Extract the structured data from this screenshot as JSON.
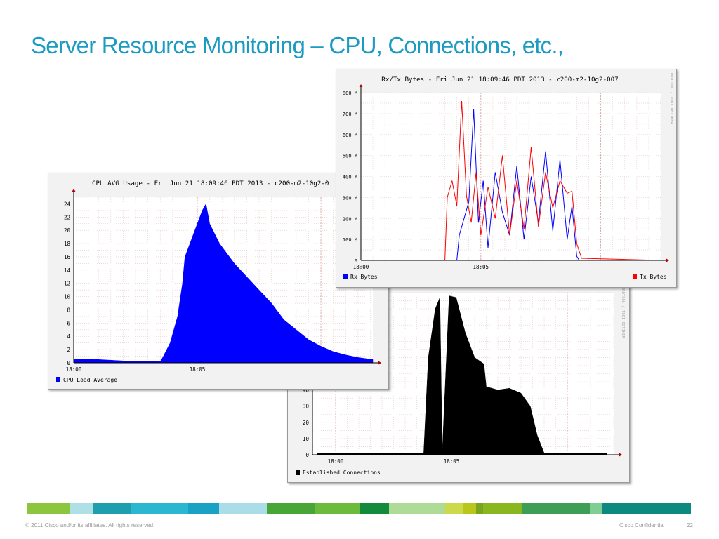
{
  "slide": {
    "title": "Server Resource Monitoring – CPU, Connections,  etc.,",
    "footer_copyright": "© 2011 Cisco and/or its affiliates. All rights reserved.",
    "footer_confidential": "Cisco Confidential",
    "page_number": "22",
    "color_bar": [
      "#8cc63e",
      "#aee0e6",
      "#1f9fae",
      "#2bb7d0",
      "#1aa2c4",
      "#aadde8",
      "#4aa537",
      "#6dbb3c",
      "#138a3c",
      "#aedc98",
      "#ccd94a",
      "#b9c61c",
      "#7aa322",
      "#8ab61f",
      "#3e9e56",
      "#7fcf95",
      "#0d8a7f"
    ]
  },
  "chart_data": [
    {
      "panel": "established-connections",
      "type": "area",
      "title": "",
      "sidebar_text": "RRDTOOL / TOBI OETIKER",
      "legend": [
        {
          "label": "Established Connections",
          "color": "#000000"
        }
      ],
      "x_tick_labels": [
        "18:00",
        "18:05"
      ],
      "xlim_minutes": [
        -1,
        12
      ],
      "y_ticks": [
        0,
        10,
        20,
        30,
        40
      ],
      "ylim": [
        0,
        100
      ],
      "series": [
        {
          "name": "Established Connections",
          "color": "#000000",
          "x": [
            -0.8,
            3.5,
            3.8,
            4.0,
            4.3,
            4.5,
            4.6,
            4.9,
            5.2,
            5.6,
            6.0,
            6.4,
            6.5,
            7.0,
            7.5,
            8.0,
            8.4,
            8.7,
            9.0,
            11.7
          ],
          "values": [
            1,
            1,
            1,
            60,
            90,
            97,
            1,
            98,
            97,
            75,
            60,
            56,
            42,
            40,
            41,
            38,
            30,
            12,
            1,
            1
          ]
        }
      ]
    },
    {
      "panel": "cpu-avg-usage",
      "type": "area",
      "title": "CPU AVG Usage - Fri Jun 21 18:09:46 PDT 2013 - c200-m2-10g2-0",
      "legend": [
        {
          "label": "CPU Load Average",
          "color": "#0000ff"
        }
      ],
      "x_tick_labels": [
        "18:00",
        "18:05"
      ],
      "xlim_minutes": [
        0,
        12.1
      ],
      "y_ticks": [
        0,
        2,
        4,
        6,
        8,
        10,
        12,
        14,
        16,
        18,
        20,
        22,
        24
      ],
      "ylim": [
        0,
        25
      ],
      "series": [
        {
          "name": "CPU Load Average",
          "color": "#0000ff",
          "x": [
            0,
            1,
            2,
            3.5,
            3.6,
            3.9,
            4.2,
            4.4,
            4.5,
            4.9,
            5.2,
            5.35,
            5.5,
            5.9,
            6.5,
            7.0,
            7.5,
            8.0,
            8.5,
            9.0,
            9.5,
            10.0,
            10.5,
            11.0,
            11.5,
            12.1
          ],
          "values": [
            0.6,
            0.5,
            0.3,
            0.2,
            0.8,
            3,
            7,
            12,
            16,
            20,
            23,
            24,
            21,
            18,
            15,
            13,
            11,
            9,
            6.5,
            5,
            3.5,
            2.5,
            1.7,
            1.2,
            0.8,
            0.5
          ]
        }
      ]
    },
    {
      "panel": "rx-tx-bytes",
      "type": "line",
      "title": "Rx/Tx Bytes - Fri Jun 21 18:09:46 PDT 2013 - c200-m2-10g2-007",
      "sidebar_text": "RRDTOOL / TOBI OETIKER",
      "legend": [
        {
          "label": "Rx Bytes",
          "color": "#0000ff"
        },
        {
          "label": "Tx Bytes",
          "color": "#ff0000"
        }
      ],
      "x_tick_labels": [
        "18:00",
        "18:05"
      ],
      "xlim_minutes": [
        0,
        12.5
      ],
      "y_tick_labels": [
        "0",
        "100 M",
        "200 M",
        "300 M",
        "400 M",
        "500 M",
        "600 M",
        "700 M",
        "800 M"
      ],
      "ylim": [
        0,
        800
      ],
      "series": [
        {
          "name": "Rx Bytes",
          "color": "#0000ff",
          "x": [
            0,
            4.0,
            4.1,
            4.5,
            4.7,
            4.9,
            5.1,
            5.3,
            5.6,
            5.9,
            6.2,
            6.5,
            6.8,
            7.1,
            7.4,
            7.7,
            8.0,
            8.3,
            8.6,
            8.8,
            9.0,
            9.1,
            12.5
          ],
          "values": [
            0,
            0,
            120,
            280,
            720,
            180,
            380,
            60,
            420,
            230,
            120,
            450,
            100,
            400,
            180,
            520,
            140,
            480,
            100,
            260,
            20,
            0,
            0
          ]
        },
        {
          "name": "Tx Bytes",
          "color": "#ff0000",
          "x": [
            0,
            3.5,
            3.6,
            3.8,
            4.0,
            4.2,
            4.4,
            4.6,
            4.8,
            5.0,
            5.3,
            5.6,
            5.9,
            6.2,
            6.5,
            6.8,
            7.1,
            7.4,
            7.7,
            8.0,
            8.3,
            8.6,
            8.8,
            9.0,
            9.2,
            12.5
          ],
          "values": [
            0,
            0,
            300,
            380,
            260,
            760,
            310,
            180,
            420,
            120,
            350,
            200,
            500,
            120,
            380,
            150,
            540,
            160,
            420,
            250,
            380,
            320,
            330,
            80,
            10,
            0
          ]
        }
      ]
    }
  ]
}
